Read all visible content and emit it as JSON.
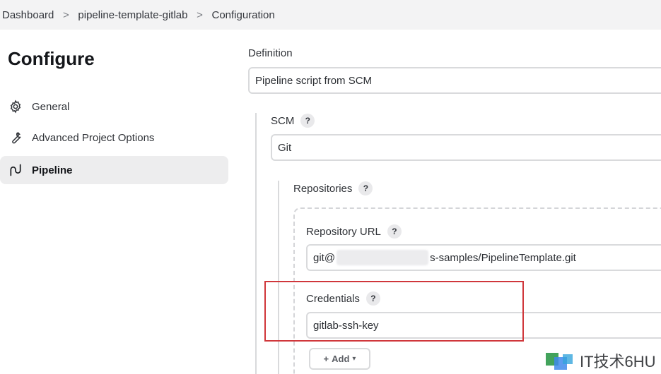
{
  "breadcrumb": {
    "items": [
      "Dashboard",
      "pipeline-template-gitlab",
      "Configuration"
    ],
    "separator": ">"
  },
  "sidebar": {
    "title": "Configure",
    "items": [
      {
        "label": "General",
        "icon": "gear-icon"
      },
      {
        "label": "Advanced Project Options",
        "icon": "wrench-icon"
      },
      {
        "label": "Pipeline",
        "icon": "pipeline-icon",
        "active": true
      }
    ]
  },
  "form": {
    "definition_label": "Definition",
    "definition_value": "Pipeline script from SCM",
    "scm_label": "SCM",
    "scm_value": "Git",
    "repositories_label": "Repositories",
    "repo_url_label": "Repository URL",
    "repo_url_prefix": "git@",
    "repo_url_suffix": "s-samples/PipelineTemplate.git",
    "credentials_label": "Credentials",
    "credentials_value": "gitlab-ssh-key",
    "add_button_label": "Add",
    "help_glyph": "?"
  },
  "watermark": {
    "text": "IT技术6HU"
  },
  "colors": {
    "highlight": "#d0373b",
    "breadcrumb_bg": "#f3f3f4",
    "active_item_bg": "#ededee"
  }
}
